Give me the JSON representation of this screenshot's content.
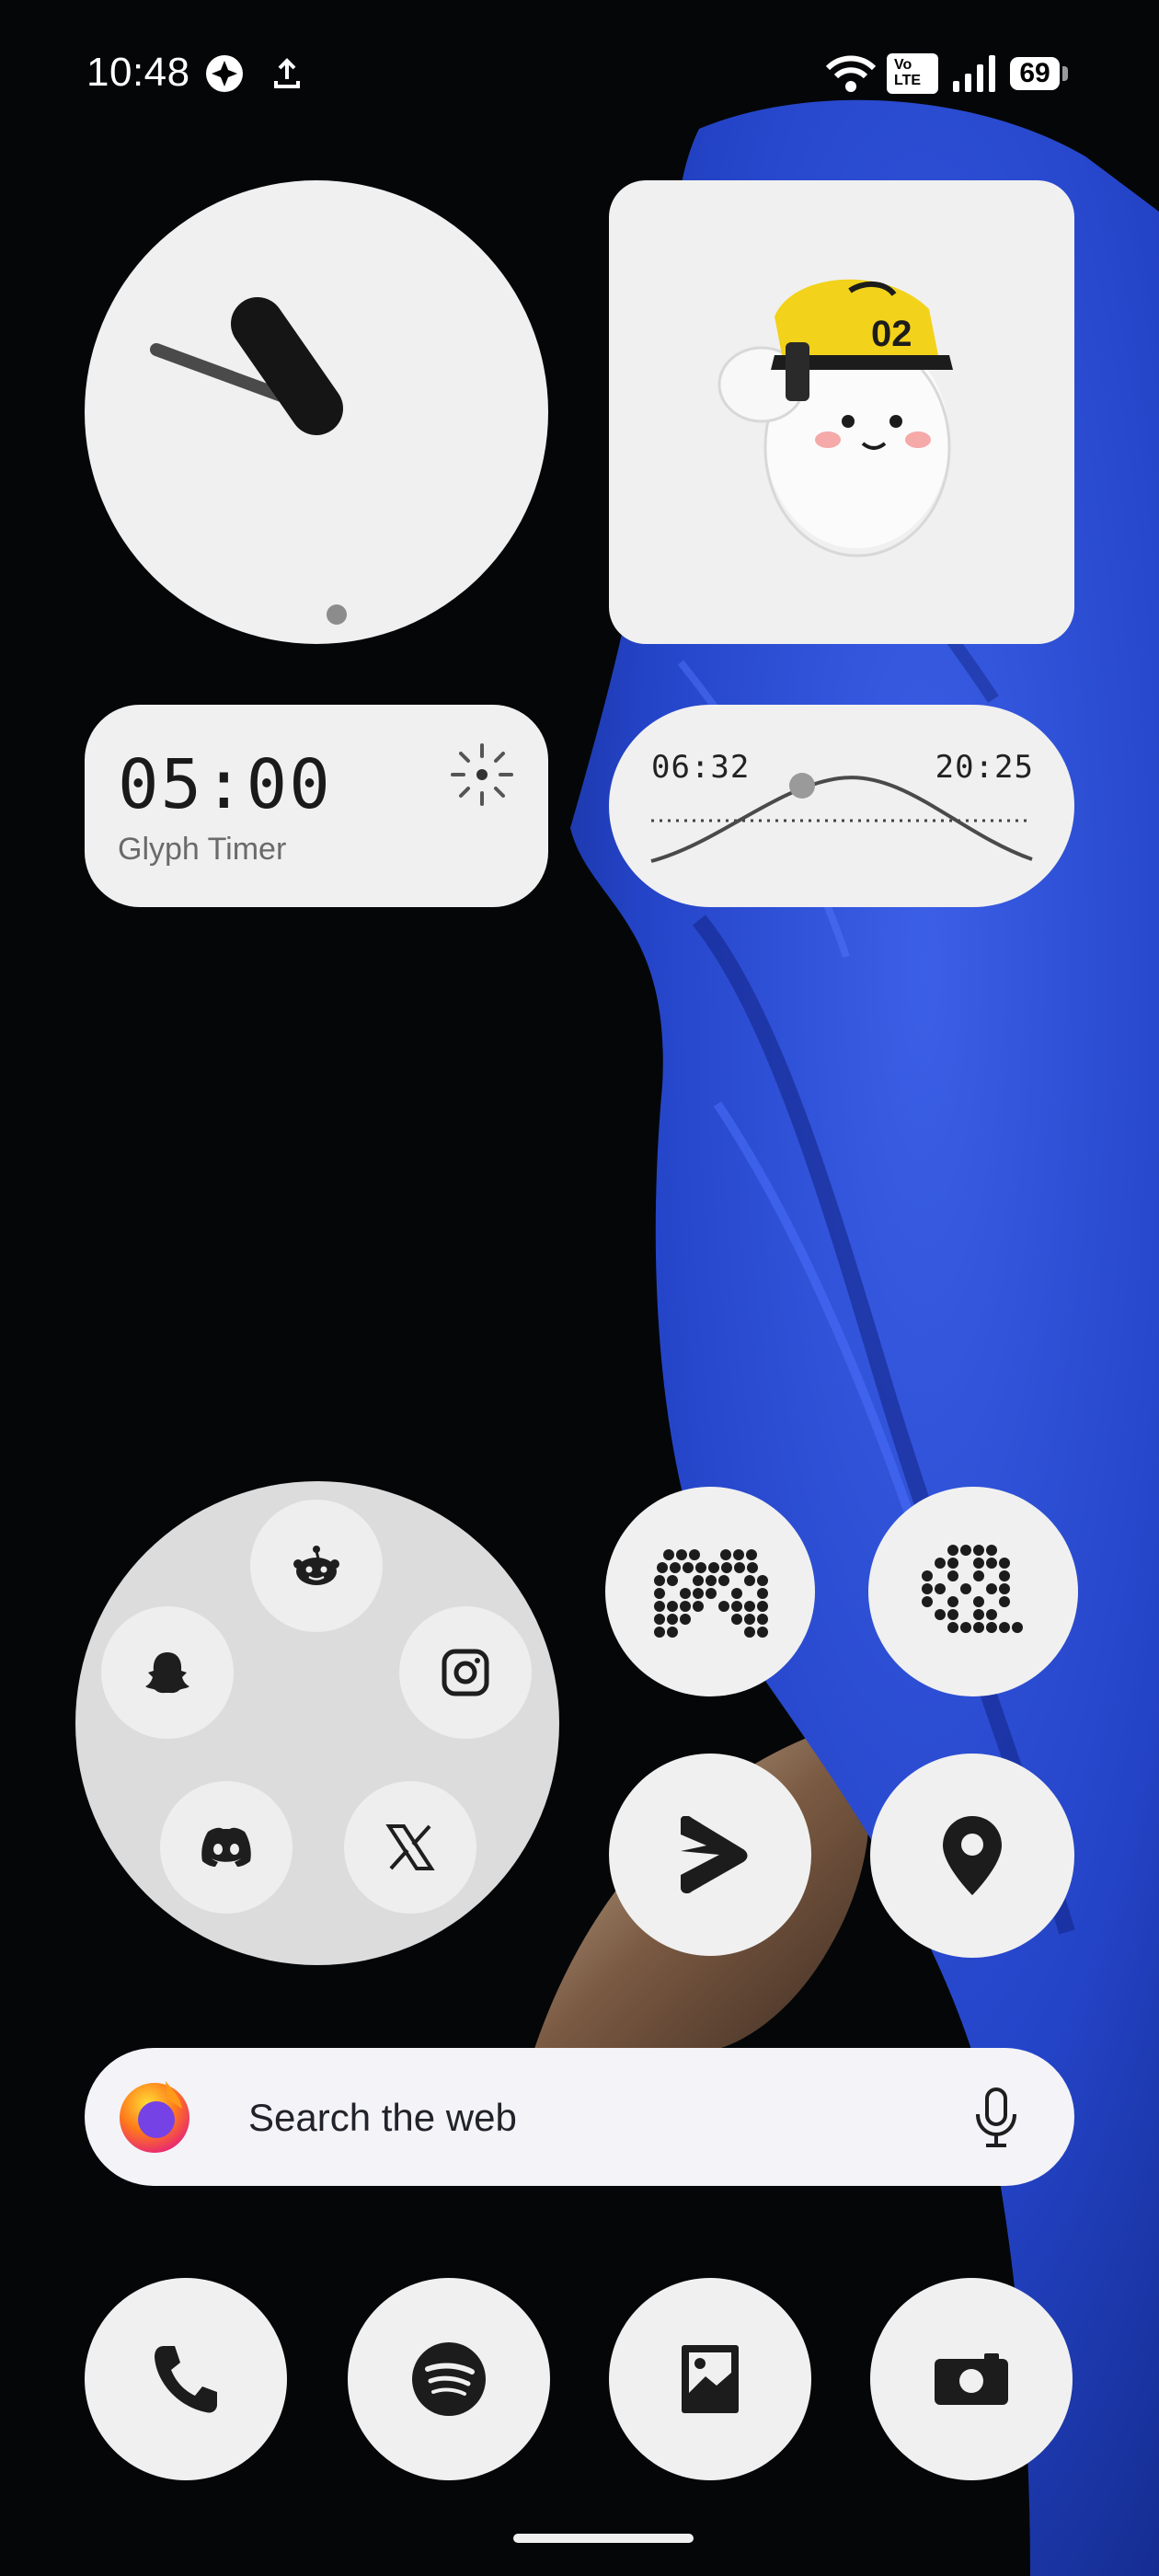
{
  "status_bar": {
    "time": "10:48",
    "network_badge": "Vo LTE",
    "battery": "69",
    "icons": [
      "pinwheel-icon",
      "upload-icon",
      "wifi-icon",
      "volte-icon",
      "signal-icon",
      "battery-icon"
    ]
  },
  "widgets": {
    "clock": {
      "hour": 10,
      "minute": 48
    },
    "timer": {
      "value": "05:00",
      "label": "Glyph Timer"
    },
    "sun": {
      "sunrise": "06:32",
      "sunset": "20:25"
    }
  },
  "folder": {
    "apps": [
      "reddit-icon",
      "snapchat-icon",
      "instagram-icon",
      "discord-icon",
      "x-icon"
    ]
  },
  "apps": [
    "gamepad-icon",
    "film-reel-icon",
    "stack-icon",
    "location-pin-icon"
  ],
  "search": {
    "placeholder": "Search the web",
    "icons": [
      "firefox-icon",
      "microphone-icon"
    ]
  },
  "dock": [
    "phone-icon",
    "spotify-icon",
    "gallery-icon",
    "camera-icon"
  ],
  "colors": {
    "widget_bg": "#f0f0f0",
    "wallpaper_bg": "#050608",
    "parrot_blue": "#2f4fd8"
  }
}
